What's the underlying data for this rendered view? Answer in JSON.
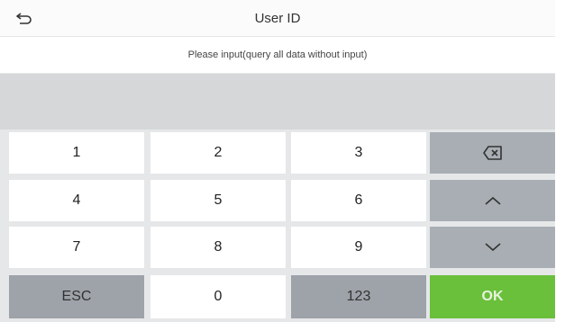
{
  "header": {
    "title": "User ID"
  },
  "hint": "Please input(query all data without input)",
  "input": {
    "value": "",
    "placeholder": ""
  },
  "keypad": {
    "rows": [
      [
        "1",
        "2",
        "3"
      ],
      [
        "4",
        "5",
        "6"
      ],
      [
        "7",
        "8",
        "9"
      ]
    ],
    "esc_label": "ESC",
    "zero_label": "0",
    "mode_label": "123",
    "ok_label": "OK"
  },
  "icons": {
    "back": "back-arrow-icon",
    "backspace": "backspace-icon",
    "up": "chevron-up-icon",
    "down": "chevron-down-icon"
  },
  "colors": {
    "ok": "#6abf3b",
    "function_key": "#a9aeb4",
    "input_background": "#d6d7d9"
  }
}
